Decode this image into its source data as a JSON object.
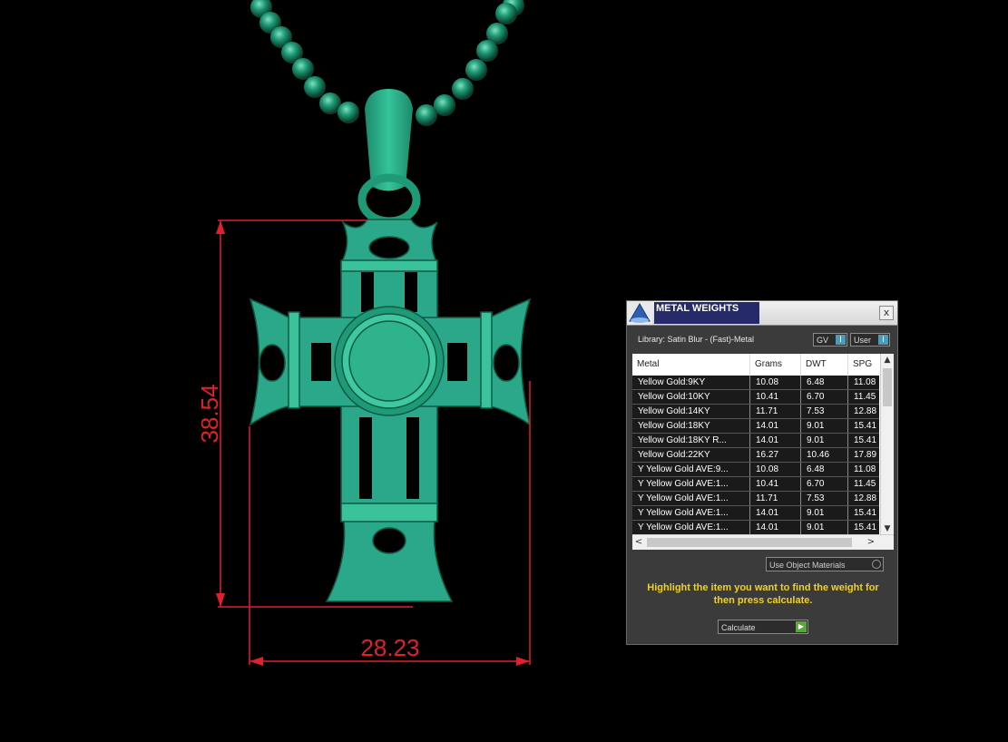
{
  "viewport": {
    "height_dimension": "38.54",
    "width_dimension": "28.23",
    "colors": {
      "background": "#000000",
      "model": "#2aa889",
      "dimension": "#e0202a"
    }
  },
  "panel": {
    "title": "METAL WEIGHTS",
    "close_label": "x",
    "library_label": "Library: Satin Blur - (Fast)-Metal",
    "gv_label": "GV",
    "user_label": "User",
    "toggle_knob": "I",
    "columns": [
      "Metal",
      "Grams",
      "DWT",
      "SPG"
    ],
    "rows": [
      [
        "Yellow Gold:9KY",
        "10.08",
        "6.48",
        "11.08"
      ],
      [
        "Yellow Gold:10KY",
        "10.41",
        "6.70",
        "11.45"
      ],
      [
        "Yellow Gold:14KY",
        "11.71",
        "7.53",
        "12.88"
      ],
      [
        "Yellow Gold:18KY",
        "14.01",
        "9.01",
        "15.41"
      ],
      [
        "Yellow Gold:18KY R...",
        "14.01",
        "9.01",
        "15.41"
      ],
      [
        "Yellow Gold:22KY",
        "16.27",
        "10.46",
        "17.89"
      ],
      [
        "Y Yellow Gold AVE:9...",
        "10.08",
        "6.48",
        "11.08"
      ],
      [
        "Y Yellow Gold AVE:1...",
        "10.41",
        "6.70",
        "11.45"
      ],
      [
        "Y Yellow Gold AVE:1...",
        "11.71",
        "7.53",
        "12.88"
      ],
      [
        "Y Yellow Gold AVE:1...",
        "14.01",
        "9.01",
        "15.41"
      ],
      [
        "Y Yellow Gold AVE:1...",
        "14.01",
        "9.01",
        "15.41"
      ]
    ],
    "use_object_materials": "Use Object Materials",
    "help_text": "Highlight the item you want to find the weight for then press calculate.",
    "calculate_label": "Calculate",
    "calculate_knob": "▶",
    "scroll_up": "▲",
    "scroll_down": "▼",
    "scroll_left": "<",
    "scroll_right": ">"
  }
}
